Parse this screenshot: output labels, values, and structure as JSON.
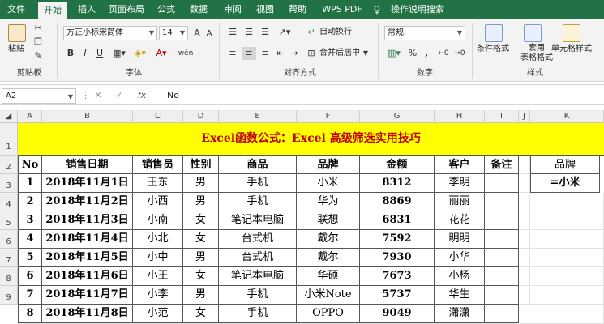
{
  "tabs": [
    "文件",
    "开始",
    "插入",
    "页面布局",
    "公式",
    "数据",
    "审阅",
    "视图",
    "帮助",
    "WPS PDF",
    "操作说明搜索"
  ],
  "ribbon": {
    "clipboard": {
      "paste": "粘贴",
      "label": "剪贴板"
    },
    "font": {
      "name": "方正小标宋简体",
      "size": "14",
      "a_grow": "A",
      "a_shrink": "A",
      "bold": "B",
      "italic": "I",
      "underline": "U",
      "wen": "wén",
      "label": "字体"
    },
    "align": {
      "wrap": "自动换行",
      "merge": "合并后居中",
      "label": "对齐方式"
    },
    "number": {
      "format": "常规",
      "pct": "%",
      "comma": ",",
      "label": "数字"
    },
    "styles": {
      "cond": "条件格式",
      "table_fmt": "套用\n表格格式",
      "cell_style": "单元格样式",
      "label": "样式"
    }
  },
  "formula_bar": {
    "namebox": "A2",
    "fx": "fx",
    "content": "No"
  },
  "columns": [
    "A",
    "B",
    "C",
    "D",
    "E",
    "F",
    "G",
    "H",
    "I",
    "J",
    "K"
  ],
  "rows": [
    "1",
    "2",
    "3",
    "4",
    "5",
    "6",
    "7",
    "8",
    "9"
  ],
  "sheet": {
    "title": "Excel函数公式：Excel 高级筛选实用技巧",
    "headers": [
      "No",
      "销售日期",
      "销售员",
      "性别",
      "商品",
      "品牌",
      "金额",
      "客户",
      "备注"
    ],
    "data": [
      [
        "1",
        "2018年11月1日",
        "王东",
        "男",
        "手机",
        "小米",
        "8312",
        "李明",
        ""
      ],
      [
        "2",
        "2018年11月2日",
        "小西",
        "男",
        "手机",
        "华为",
        "8869",
        "丽丽",
        ""
      ],
      [
        "3",
        "2018年11月3日",
        "小南",
        "女",
        "笔记本电脑",
        "联想",
        "6831",
        "花花",
        ""
      ],
      [
        "4",
        "2018年11月4日",
        "小北",
        "女",
        "台式机",
        "戴尔",
        "7592",
        "明明",
        ""
      ],
      [
        "5",
        "2018年11月5日",
        "小中",
        "男",
        "台式机",
        "戴尔",
        "7930",
        "小华",
        ""
      ],
      [
        "6",
        "2018年11月6日",
        "小王",
        "女",
        "笔记本电脑",
        "华硕",
        "7673",
        "小杨",
        ""
      ],
      [
        "7",
        "2018年11月7日",
        "小李",
        "男",
        "手机",
        "小米Note",
        "5737",
        "华生",
        ""
      ],
      [
        "8",
        "2018年11月8日",
        "小范",
        "女",
        "手机",
        "OPPO",
        "9049",
        "潇潇",
        ""
      ]
    ],
    "criteria_header": "品牌",
    "criteria_value": "=小米"
  },
  "colors": {
    "ribbon_green": "#217346",
    "title_fill": "#ffff00",
    "title_text": "#c00000"
  }
}
